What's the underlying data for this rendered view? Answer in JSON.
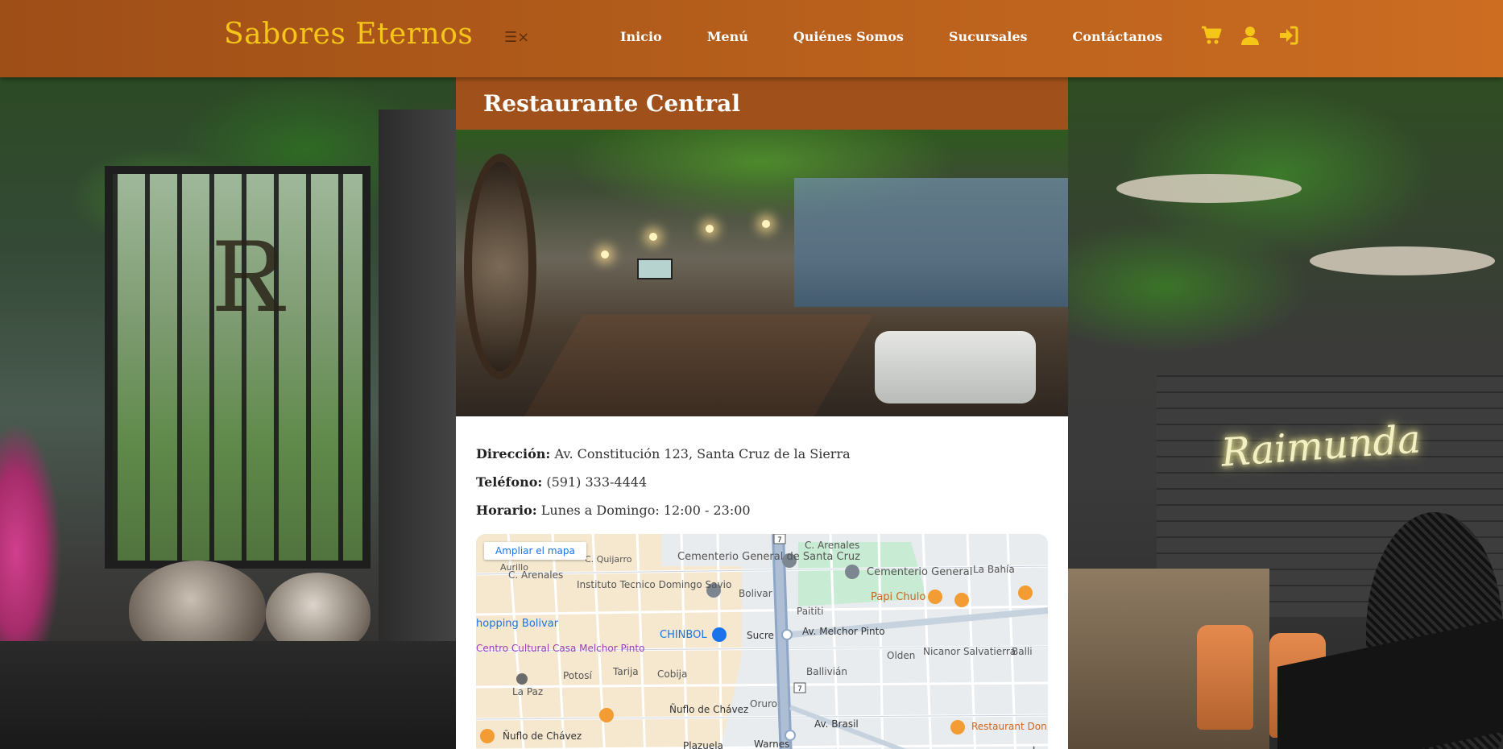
{
  "nav": {
    "brand": "Sabores Eternos",
    "toggle_glyph": "☰×",
    "links": [
      "Inicio",
      "Menú",
      "Quiénes Somos",
      "Sucursales",
      "Contáctanos"
    ],
    "icons": [
      "cart-icon",
      "user-icon",
      "sign-in-icon"
    ],
    "icon_color": "#f5c518"
  },
  "card": {
    "title": "Restaurante Central",
    "address_label": "Dirección:",
    "address": "Av. Constitución 123, Santa Cruz de la Sierra",
    "phone_label": "Teléfono:",
    "phone": "(591) 333-4444",
    "hours_label": "Horario:",
    "hours": "Lunes a Domingo: 12:00 - 23:00"
  },
  "background_decor": {
    "left_sign": "Я",
    "right_neon": "Raimunda"
  },
  "map": {
    "enlarge_label": "Ampliar el mapa",
    "labels": {
      "cementerio_general_santa_cruz": "Cementerio General de Santa Cruz",
      "cementerio_general": "Cementerio General",
      "la_bahia": "La Bahía",
      "c_arenales_top": "C. Arenales",
      "c_arenales_left": "C. Arenales",
      "instituto": "Instituto Tecnico Domingo Savio",
      "bolivar": "Bolivar",
      "paitit": "Paititi",
      "papi_chulo": "Papi Chulo",
      "shopping": "hopping Bolivar",
      "chinbol": "CHINBOL",
      "sucre": "Sucre",
      "av_melchor_pinto": "Av. Melchor Pinto",
      "centro_cultural": "Centro Cultural Casa Melchor Pinto",
      "potosi": "Potosí",
      "tarija": "Tarija",
      "cobija": "Cobija",
      "ballivian": "Ballivián",
      "olden": "Olden",
      "nicanor": "Nicanor Salvatierra",
      "la_paz": "La Paz",
      "nuflo_1": "Ñuflo de Chávez",
      "nuflo_2": "Ñuflo de Chávez",
      "oruro": "Oruro",
      "av_brasil": "Av. Brasil",
      "warnes": "Warnes",
      "plazuela": "Plazuela",
      "restaurant_don": "Restaurant Don",
      "quijarro": "C. Quijarro",
      "aurillo": "Aurillo",
      "balli_right": "Balli",
      "route_7a": "7",
      "route_7b": "7",
      "zoom_plus": "+"
    }
  }
}
